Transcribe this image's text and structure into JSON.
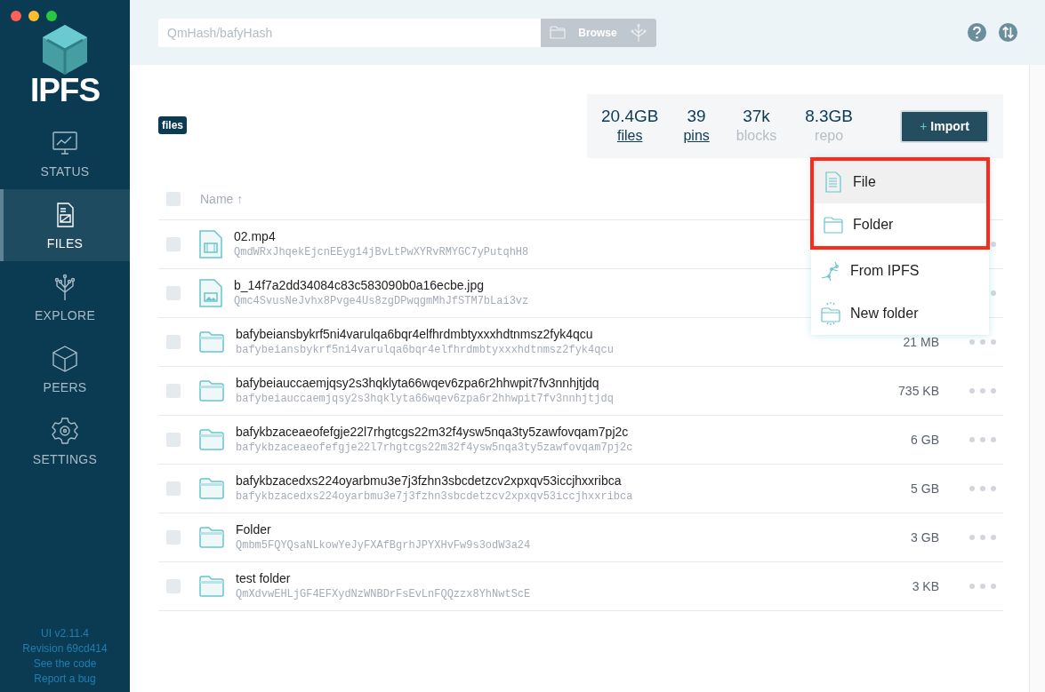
{
  "window_controls": [
    {
      "color": "#fe5f57"
    },
    {
      "color": "#febc2e"
    },
    {
      "color": "#28c840"
    }
  ],
  "sidebar": {
    "logo": "IPFS",
    "items": [
      {
        "kind": "status",
        "label": "STATUS",
        "selected": false
      },
      {
        "kind": "files",
        "label": "FILES",
        "selected": true
      },
      {
        "kind": "explore",
        "label": "EXPLORE",
        "selected": false
      },
      {
        "kind": "peers",
        "label": "PEERS",
        "selected": false
      },
      {
        "kind": "settings",
        "label": "SETTINGS",
        "selected": false
      }
    ],
    "footer": [
      "UI v2.11.4",
      "Revision 69cd414",
      "See the code",
      "Report a bug"
    ]
  },
  "search": {
    "placeholder": "QmHash/bafyHash",
    "button": "Browse"
  },
  "breadcrumb": "files",
  "stats": [
    {
      "value": "20.4GB",
      "label": "files",
      "link": true
    },
    {
      "value": "39",
      "label": "pins",
      "link": true
    },
    {
      "value": "37k",
      "label": "blocks",
      "link": false
    },
    {
      "value": "8.3GB",
      "label": "repo",
      "link": false
    }
  ],
  "import_button": {
    "icon": "+",
    "label": "Import"
  },
  "import_menu": [
    {
      "kind": "file",
      "label": "File",
      "selected": true,
      "highlighted": true
    },
    {
      "kind": "folder",
      "label": "Folder",
      "selected": false,
      "highlighted": true
    },
    {
      "kind": "ipfs",
      "label": "From IPFS",
      "selected": false,
      "highlighted": false
    },
    {
      "kind": "new_folder",
      "label": "New folder",
      "selected": false,
      "highlighted": false
    }
  ],
  "table": {
    "select_all": {
      "checked": false
    },
    "columns": [
      {
        "label": "Name",
        "sort": "↑"
      }
    ],
    "rows": [
      {
        "kind": "video",
        "name": "02.mp4",
        "hash": "QmdWRxJhqekEjcnEEyg14jBvLtPwXYRvRMYGC7yPutqhH8",
        "checked": false
      },
      {
        "kind": "image",
        "name": "b_14f7a2dd34084c83c583090b0a16ecbe.jpg",
        "hash": "Qmc4SvusNeJvhx8Pvge4Us8zgDPwqgmMhJfSTM7bLai3vz",
        "checked": false
      },
      {
        "kind": "folder",
        "name": "bafybeiansbykrf5ni4varulqa6bqr4elfhrdmbtyxxxhdtnmsz2fyk4qcu",
        "hash": "bafybeiansbykrf5ni4varulqa6bqr4elfhrdmbtyxxxhdtnmsz2fyk4qcu",
        "size": "21 MB",
        "checked": false
      },
      {
        "kind": "folder",
        "name": "bafybeiauccaemjqsy2s3hqklyta66wqev6zpa6r2hhwpit7fv3nnhjtjdq",
        "hash": "bafybeiauccaemjqsy2s3hqklyta66wqev6zpa6r2hhwpit7fv3nnhjtjdq",
        "size": "735 KB",
        "checked": false
      },
      {
        "kind": "folder",
        "name": "bafykbzaceaeofefgje22l7rhgtcgs22m32f4ysw5nqa3ty5zawfovqam7pj2c",
        "hash": "bafykbzaceaeofefgje22l7rhgtcgs22m32f4ysw5nqa3ty5zawfovqam7pj2c",
        "size": "6 GB",
        "checked": false
      },
      {
        "kind": "folder",
        "name": "bafykbzacedxs224oyarbmu3e7j3fzhn3sbcdetzcv2xpxqv53iccjhxxribca",
        "hash": "bafykbzacedxs224oyarbmu3e7j3fzhn3sbcdetzcv2xpxqv53iccjhxxribca",
        "size": "5 GB",
        "checked": false
      },
      {
        "kind": "folder",
        "name": "Folder",
        "hash": "Qmbm5FQYQsaNLkowYeJyFXAfBgrhJPYXHvFw9s3odW3a24",
        "size": "3 GB",
        "checked": false
      },
      {
        "kind": "folder",
        "name": "test folder",
        "hash": "QmXdvwEHLjGF4EFXydNzWNBDrFsEvLnFQQzzx8YhNwtScE",
        "size": "3 KB",
        "checked": false
      }
    ]
  }
}
